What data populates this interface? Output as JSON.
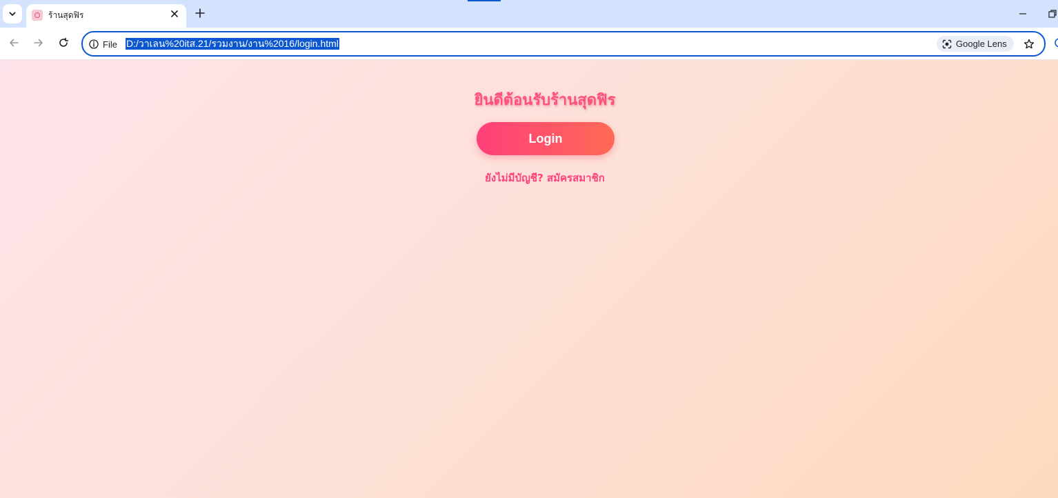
{
  "browser": {
    "tab": {
      "title": "ร้านสุดฟิร"
    },
    "omnibox": {
      "site_info_label": "File",
      "url": "D:/วาเลน%20itส.21/รวมงาน/งาน%2016/login.html",
      "lens_label": "Google Lens"
    },
    "accent_color": "#0b57d0"
  },
  "page": {
    "welcome_title": "ยินดีต้อนรับร้านสุดฟิร",
    "login_button_label": "Login",
    "register_link_text": "ยังไม่มีบัญชี? สมัครสมาชิก",
    "brand_color": "#ff4f7b",
    "button_gradient": [
      "#ff3f7b",
      "#ff6a55"
    ],
    "background_gradient": [
      "#ffe3ea",
      "#fdd9bf"
    ]
  }
}
